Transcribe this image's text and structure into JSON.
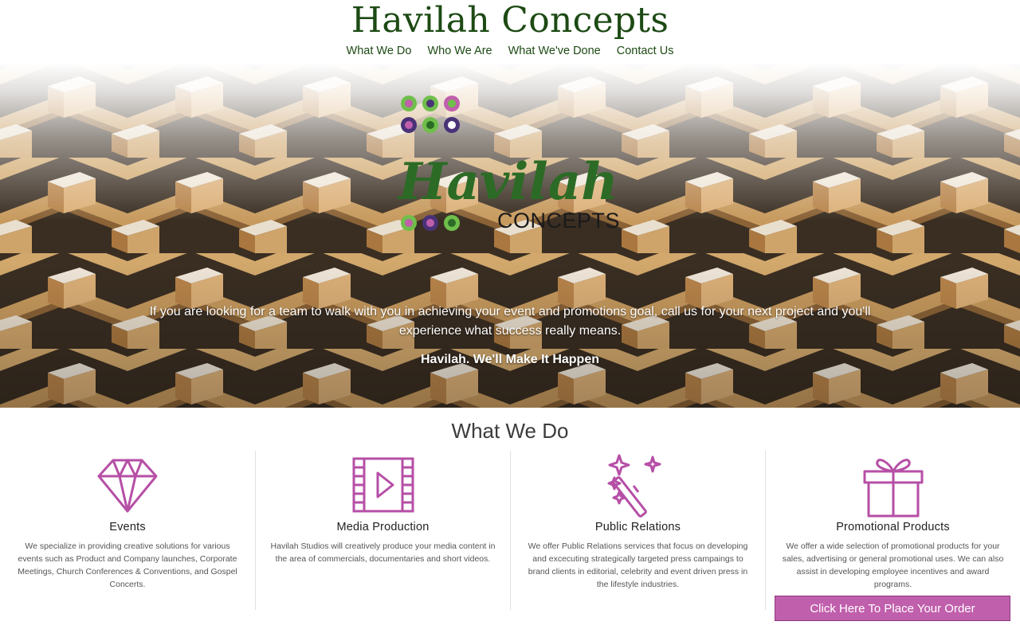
{
  "header": {
    "title": "Havilah Concepts",
    "nav": [
      "What We Do",
      "Who We Are",
      "What We've Done",
      "Contact Us"
    ]
  },
  "hero": {
    "logo_script": "Havilah",
    "logo_sub": "CONCEPTS",
    "text": "If you are looking for a team to walk with you in achieving your event and promotions goal, call us for your next project and you'll experience what success really means.",
    "tagline": "Havilah. We'll Make It Happen"
  },
  "section": {
    "title": "What We Do",
    "services": [
      {
        "icon": "diamond-icon",
        "title": "Events",
        "text": "We specialize in providing creative solutions for various events such as Product and Company launches, Corporate Meetings, Church Conferences & Conventions, and Gospel Concerts."
      },
      {
        "icon": "video-film-icon",
        "title": "Media Production",
        "text": "Havilah Studios will creatively produce your media content in the area of commercials, documentaries and short videos."
      },
      {
        "icon": "magic-wand-icon",
        "title": "Public Relations",
        "text": "We offer Public Relations services that focus on developing and excecuting strategically targeted press campaings to brand clients in editorial, celebrity and event driven press in the lifestyle industries."
      },
      {
        "icon": "gift-icon",
        "title": "Promotional Products",
        "text": "We offer a wide selection of promotional products for your sales, advertising or general promotional uses. We can also assist in developing employee incentives and award programs."
      }
    ],
    "order_button": "Click Here To Place Your Order"
  },
  "colors": {
    "brand_green": "#1d4a14",
    "accent_purple": "#c05fac",
    "icon_magenta": "#b64fa6"
  }
}
